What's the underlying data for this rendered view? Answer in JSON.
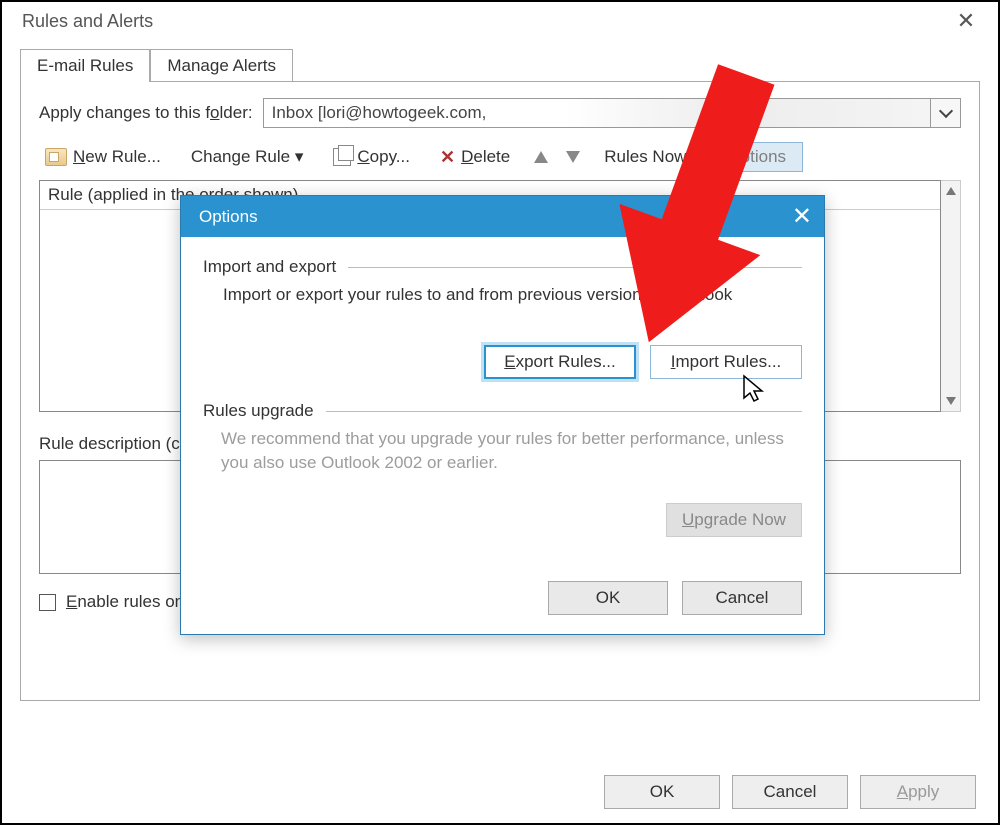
{
  "parent": {
    "title": "Rules and Alerts",
    "tabs": {
      "email_rules": "E-mail Rules",
      "manage_alerts": "Manage Alerts"
    },
    "folder_label_pre": "Apply changes to this f",
    "folder_label_u": "o",
    "folder_label_post": "lder:",
    "folder_value": "Inbox [lori@howtogeek.com,",
    "toolbar": {
      "new_pre": "",
      "new_u": "N",
      "new_post": "ew Rule...",
      "change": "Change Rule ▾",
      "copy_u": "C",
      "copy_post": "opy...",
      "delete_u": "D",
      "delete_post": "elete",
      "runnow": "Rules Now",
      "options": "Options"
    },
    "rulelist_header": "Rule (applied in the order shown)",
    "desc_label": "Rule description (click an underlined value to edit):",
    "rss_pre": "",
    "rss_u": "E",
    "rss_post": "nable rules on all messages downloaded from RSS Feeds",
    "ok": "OK",
    "cancel": "Cancel",
    "apply_u": "A",
    "apply_post": "pply"
  },
  "options": {
    "title": "Options",
    "sec1_title": "Import and export",
    "sec1_desc": "Import or export your rules to and from previous versions of Outlook",
    "export_u": "E",
    "export_post": "xport Rules...",
    "import_u": "I",
    "import_post": "mport Rules...",
    "sec2_title": "Rules upgrade",
    "sec2_desc": "We recommend that you upgrade your rules for better performance, unless you also use Outlook 2002 or earlier.",
    "upgrade_u": "U",
    "upgrade_post": "pgrade Now",
    "ok": "OK",
    "cancel": "Cancel"
  }
}
